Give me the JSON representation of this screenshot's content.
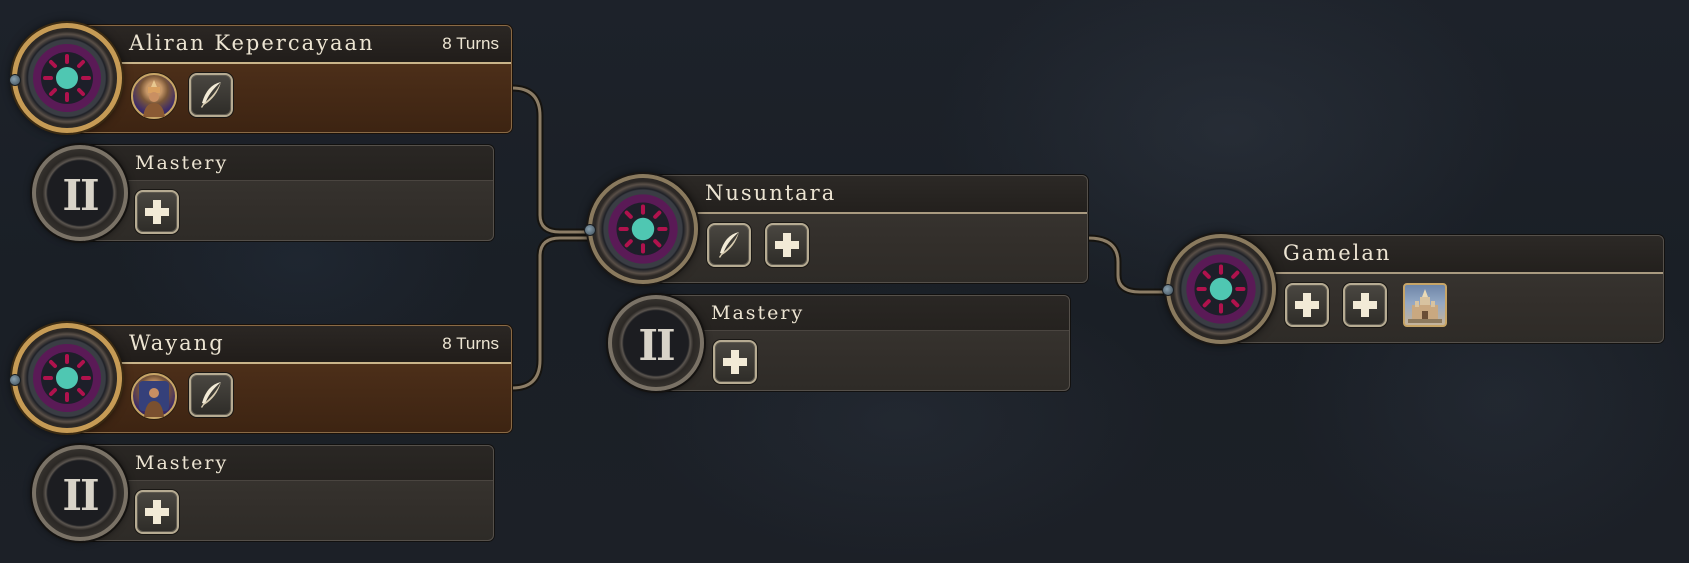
{
  "tree": {
    "nodes": [
      {
        "id": "aliran",
        "title": "Aliran Kepercayaan",
        "turns": "8 Turns",
        "status": "in-progress",
        "icons": [
          "figure-portrait-icon",
          "quill-icon"
        ]
      },
      {
        "id": "aliran-mastery",
        "title": "Mastery",
        "roman": "II",
        "icons": [
          "plus-icon"
        ]
      },
      {
        "id": "wayang",
        "title": "Wayang",
        "turns": "8 Turns",
        "status": "in-progress",
        "icons": [
          "figure-portrait-icon",
          "quill-icon"
        ]
      },
      {
        "id": "wayang-mastery",
        "title": "Mastery",
        "roman": "II",
        "icons": [
          "plus-icon"
        ]
      },
      {
        "id": "nusuntara",
        "title": "Nusuntara",
        "icons": [
          "quill-icon",
          "plus-icon"
        ]
      },
      {
        "id": "nusuntara-mastery",
        "title": "Mastery",
        "roman": "II",
        "icons": [
          "plus-icon"
        ]
      },
      {
        "id": "gamelan",
        "title": "Gamelan",
        "icons": [
          "plus-icon",
          "plus-icon",
          "wonder-building-icon"
        ]
      }
    ],
    "links": [
      [
        "aliran",
        "nusuntara"
      ],
      [
        "wayang",
        "nusuntara"
      ],
      [
        "nusuntara",
        "gamelan"
      ]
    ]
  },
  "colors": {
    "emblem_teal": "#4fc7b2",
    "emblem_crimson": "#b0124d",
    "emblem_ring": "#7a1f6b",
    "in_progress_bar": "#4a2d18",
    "frame_gold": "#c69b55",
    "background": "#1c2027"
  }
}
